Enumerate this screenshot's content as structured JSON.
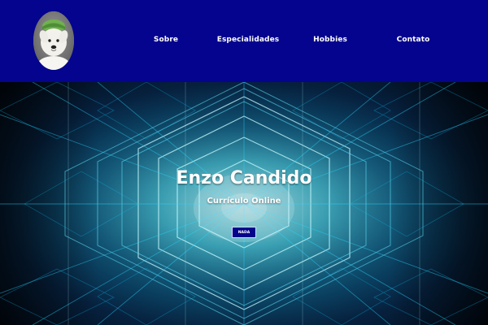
{
  "header": {
    "nav_items": [
      {
        "label": "Sobre"
      },
      {
        "label": "Especialidades"
      },
      {
        "label": "Hobbies"
      },
      {
        "label": "Contato"
      }
    ],
    "avatar": {
      "icon_name": "dog-avatar-icon"
    }
  },
  "hero": {
    "title": "Enzo Candido",
    "subtitle": "Currículo Online",
    "button_label": "NADA"
  },
  "colors": {
    "header_bg": "#04048f",
    "button_bg": "#05058c",
    "hero_cyan": "#2fa7c2",
    "hero_dark": "#020914",
    "text_white": "#ffffff"
  }
}
